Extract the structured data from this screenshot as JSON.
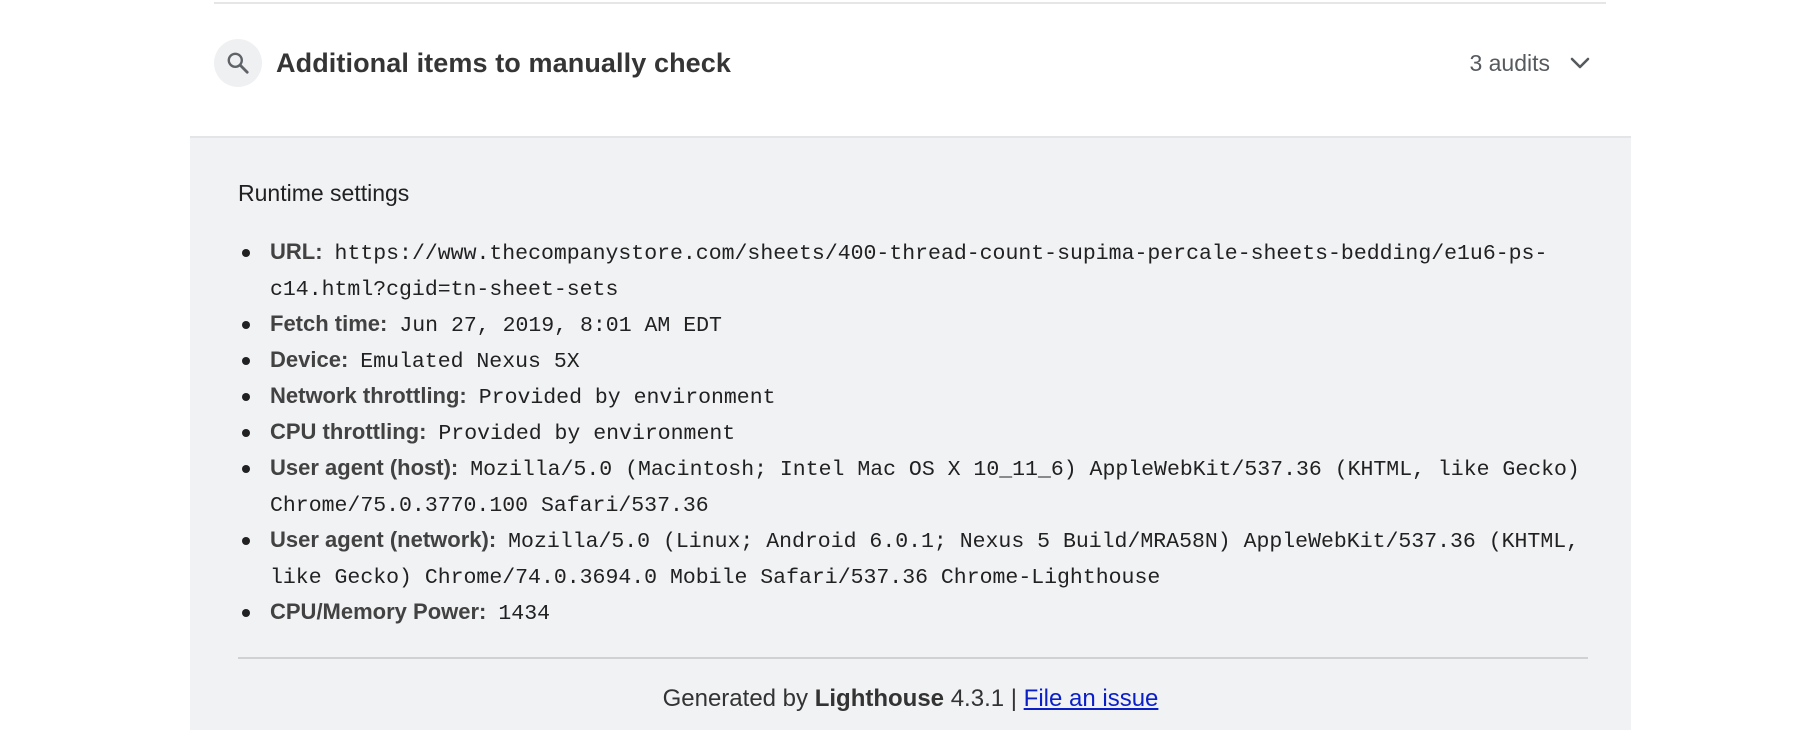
{
  "group": {
    "title": "Additional items to manually check",
    "count": "3 audits",
    "icon": "search-icon",
    "expand_icon": "chevron-down-icon"
  },
  "footer": {
    "title": "Runtime settings",
    "items": [
      {
        "name": "URL:",
        "desc": "https://www.thecompanystore.com/sheets/400-thread-count-supima-percale-sheets-bedding/e1u6-ps-c14.html?cgid=tn-sheet-sets"
      },
      {
        "name": "Fetch time:",
        "desc": "Jun 27, 2019, 8:01 AM EDT"
      },
      {
        "name": "Device:",
        "desc": "Emulated Nexus 5X"
      },
      {
        "name": "Network throttling:",
        "desc": "Provided by environment"
      },
      {
        "name": "CPU throttling:",
        "desc": "Provided by environment"
      },
      {
        "name": "User agent (host):",
        "desc": "Mozilla/5.0 (Macintosh; Intel Mac OS X 10_11_6) AppleWebKit/537.36 (KHTML, like Gecko) Chrome/75.0.3770.100 Safari/537.36"
      },
      {
        "name": "User agent (network):",
        "desc": "Mozilla/5.0 (Linux; Android 6.0.1; Nexus 5 Build/MRA58N) AppleWebKit/537.36 (KHTML, like Gecko) Chrome/74.0.3694.0 Mobile Safari/537.36 Chrome-Lighthouse"
      },
      {
        "name": "CPU/Memory Power:",
        "desc": "1434"
      }
    ],
    "generated": {
      "prefix": "Generated by",
      "product": "Lighthouse",
      "version": "4.3.1 |",
      "link_label": "File an issue"
    }
  },
  "colors": {
    "footer_bg": "#f1f2f4",
    "link": "#0b1fc7",
    "text": "#212121"
  }
}
